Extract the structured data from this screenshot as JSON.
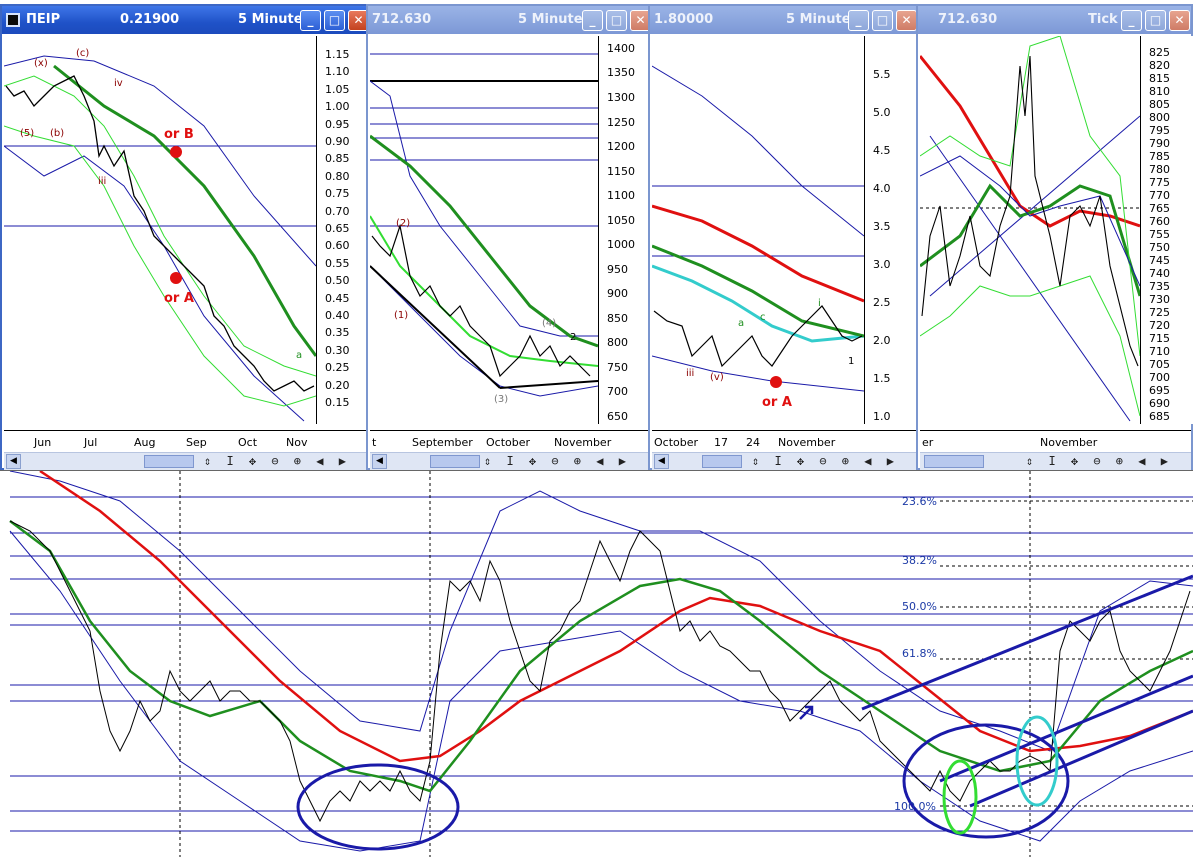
{
  "windows": [
    {
      "symbol": "ΠΕΙΡ",
      "value": "0.21900",
      "interval": "5 Minute",
      "yaxis": [
        "1.15",
        "1.10",
        "1.05",
        "1.00",
        "0.95",
        "0.90",
        "0.85",
        "0.80",
        "0.75",
        "0.70",
        "0.65",
        "0.60",
        "0.55",
        "0.50",
        "0.45",
        "0.40",
        "0.35",
        "0.30",
        "0.25",
        "0.20",
        "0.15"
      ],
      "xaxis": [
        "Jun",
        "Jul",
        "Aug",
        "Sep",
        "Oct",
        "Nov"
      ],
      "annotations": [
        "or B",
        "or A",
        "(x)",
        "(c)",
        "(5)",
        "(b)",
        "iv",
        "iii",
        "a"
      ]
    },
    {
      "symbol": "",
      "value": "712.630",
      "interval": "5 Minute",
      "yaxis": [
        "1400",
        "1350",
        "1300",
        "1250",
        "1200",
        "1150",
        "1100",
        "1050",
        "1000",
        "950",
        "900",
        "850",
        "800",
        "750",
        "700",
        "650"
      ],
      "xaxis": [
        "t",
        "September",
        "October",
        "November"
      ],
      "annotations": [
        "(2)",
        "(1)",
        "(3)",
        "(4)",
        "2"
      ]
    },
    {
      "symbol": "",
      "value": "1.80000",
      "interval": "5 Minute",
      "yaxis": [
        "5.5",
        "5.0",
        "4.5",
        "4.0",
        "3.5",
        "3.0",
        "2.5",
        "2.0",
        "1.5",
        "1.0"
      ],
      "xaxis": [
        "October",
        "17",
        "24",
        "November"
      ],
      "annotations": [
        "or A",
        "iii",
        "(v)",
        "a",
        "c",
        "i",
        "1"
      ]
    },
    {
      "symbol": "",
      "value": "712.630",
      "interval": "Tick",
      "yaxis": [
        "825",
        "820",
        "815",
        "810",
        "805",
        "800",
        "795",
        "790",
        "785",
        "780",
        "775",
        "770",
        "765",
        "760",
        "755",
        "750",
        "745",
        "740",
        "735",
        "730",
        "725",
        "720",
        "715",
        "710",
        "705",
        "700",
        "695",
        "690",
        "685"
      ],
      "xaxis": [
        "er",
        "November"
      ],
      "annotations": []
    }
  ],
  "window_buttons": {
    "minimize": "_",
    "maximize": "□",
    "close": "✕"
  },
  "scroll_tools": "⇕ I ✥ ⊖ ⊕ ◀ ▶ ⊟",
  "main_chart": {
    "fib_levels": [
      "23.6%",
      "38.2%",
      "50.0%",
      "61.8%",
      "100.0%"
    ]
  },
  "colors": {
    "price": "#000000",
    "ma_green": "#1f8f1f",
    "ma_red": "#e01010",
    "bands": "#1a1aa8",
    "light_green": "#33dd33",
    "cyan": "#33cccc",
    "title_active": "#2456d6"
  }
}
